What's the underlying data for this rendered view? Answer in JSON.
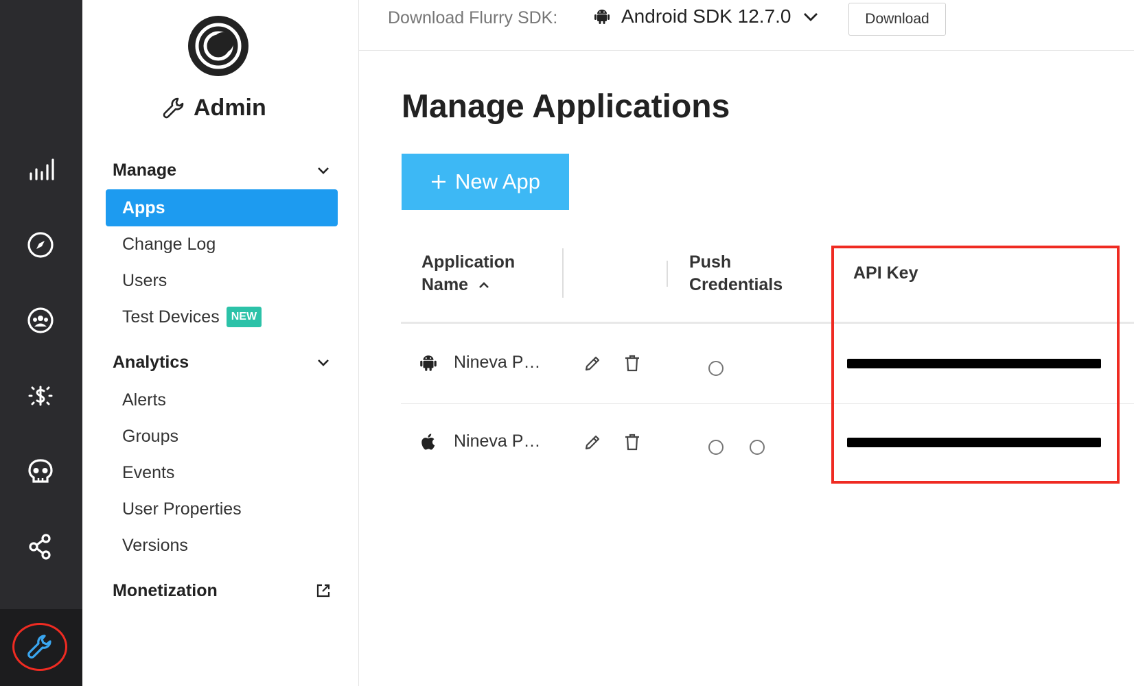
{
  "admin": {
    "title": "Admin"
  },
  "sidebar": {
    "manage_label": "Manage",
    "manage_items": [
      "Apps",
      "Change Log",
      "Users",
      "Test Devices"
    ],
    "test_devices_badge": "NEW",
    "analytics_label": "Analytics",
    "analytics_items": [
      "Alerts",
      "Groups",
      "Events",
      "User Properties",
      "Versions"
    ],
    "monetization_label": "Monetization"
  },
  "topbar": {
    "sdk_label": "Download Flurry SDK:",
    "sdk_selected": "Android SDK 12.7.0",
    "download_label": "Download"
  },
  "main": {
    "title": "Manage Applications",
    "new_app_label": "New App",
    "columns": {
      "app_name_line1": "Application",
      "app_name_line2": "Name",
      "push_line1": "Push",
      "push_line2": "Credentials",
      "api_key": "API Key"
    },
    "rows": [
      {
        "platform": "android",
        "name": "Nineva P…"
      },
      {
        "platform": "apple",
        "name": "Nineva P…"
      }
    ]
  },
  "colors": {
    "accent": "#1d9bf0",
    "new_app_button": "#3db8f5",
    "badge": "#2cc2a8",
    "highlight": "#ef2b22",
    "rail": "#2b2b2e"
  }
}
